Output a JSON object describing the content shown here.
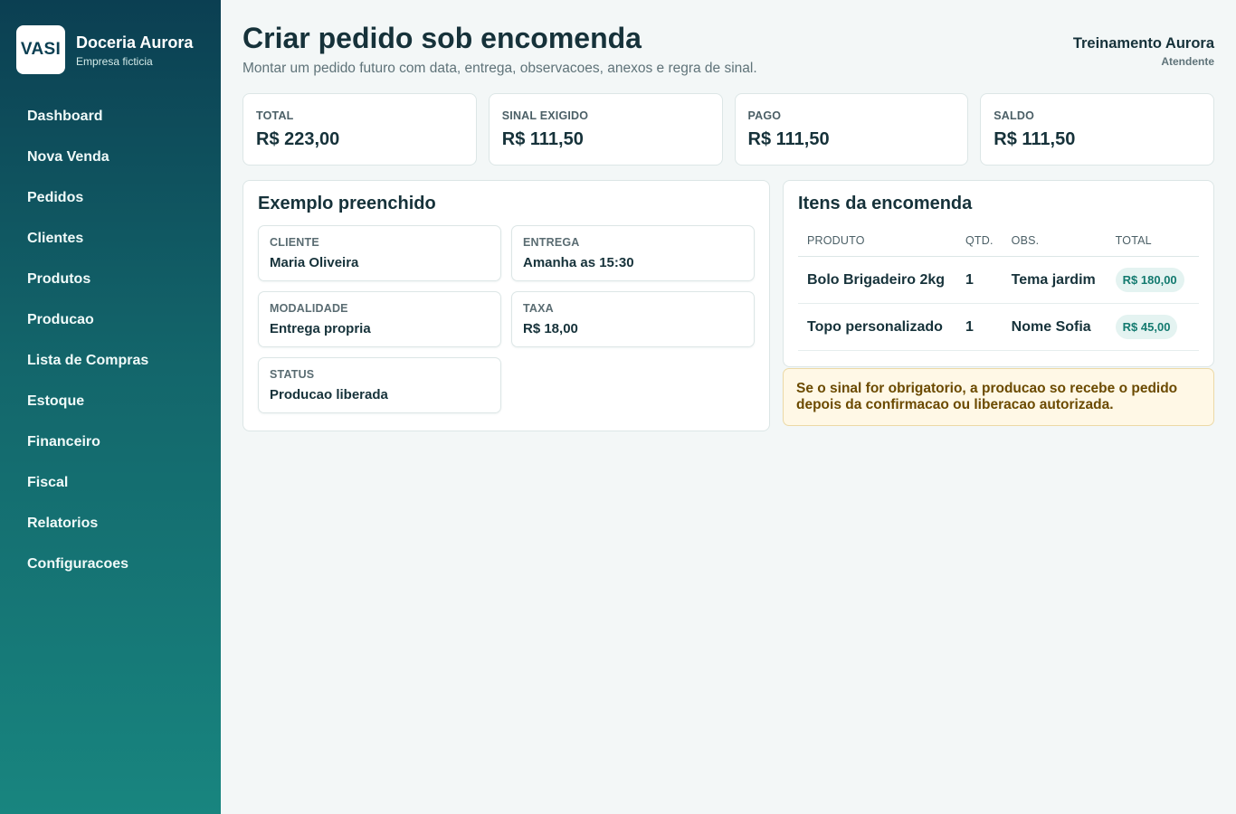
{
  "brand": {
    "logo_text": "VASI",
    "name": "Doceria Aurora",
    "subtitle": "Empresa ficticia"
  },
  "nav": {
    "items": [
      {
        "label": "Dashboard"
      },
      {
        "label": "Nova Venda"
      },
      {
        "label": "Pedidos"
      },
      {
        "label": "Clientes"
      },
      {
        "label": "Produtos"
      },
      {
        "label": "Producao"
      },
      {
        "label": "Lista de Compras"
      },
      {
        "label": "Estoque"
      },
      {
        "label": "Financeiro"
      },
      {
        "label": "Fiscal"
      },
      {
        "label": "Relatorios"
      },
      {
        "label": "Configuracoes"
      }
    ]
  },
  "header": {
    "title": "Criar pedido sob encomenda",
    "subtitle": "Montar um pedido futuro com data, entrega, observacoes, anexos e regra de sinal."
  },
  "user": {
    "name": "Treinamento Aurora",
    "role": "Atendente"
  },
  "stats": [
    {
      "label": "TOTAL",
      "value": "R$ 223,00"
    },
    {
      "label": "SINAL EXIGIDO",
      "value": "R$ 111,50"
    },
    {
      "label": "PAGO",
      "value": "R$ 111,50"
    },
    {
      "label": "SALDO",
      "value": "R$ 111,50"
    }
  ],
  "example": {
    "title": "Exemplo preenchido",
    "fields": [
      {
        "label": "CLIENTE",
        "value": "Maria Oliveira"
      },
      {
        "label": "ENTREGA",
        "value": "Amanha as 15:30"
      },
      {
        "label": "MODALIDADE",
        "value": "Entrega propria"
      },
      {
        "label": "TAXA",
        "value": "R$ 18,00"
      },
      {
        "label": "STATUS",
        "value": "Producao liberada"
      }
    ]
  },
  "items": {
    "title": "Itens da encomenda",
    "columns": [
      "PRODUTO",
      "QTD.",
      "OBS.",
      "TOTAL"
    ],
    "rows": [
      {
        "produto": "Bolo Brigadeiro 2kg",
        "qtd": "1",
        "obs": "Tema jardim",
        "total": "R$ 180,00"
      },
      {
        "produto": "Topo personalizado",
        "qtd": "1",
        "obs": "Nome Sofia",
        "total": "R$ 45,00"
      }
    ]
  },
  "notice": {
    "text": "Se o sinal for obrigatorio, a producao so recebe o pedido depois da confirmacao ou liberacao autorizada."
  },
  "colors": {
    "sidebar_top": "#0b3f52",
    "sidebar_bottom": "#18857f",
    "accent": "#137a6f",
    "notice_bg": "#fff8e6",
    "notice_text": "#6b4a00"
  }
}
